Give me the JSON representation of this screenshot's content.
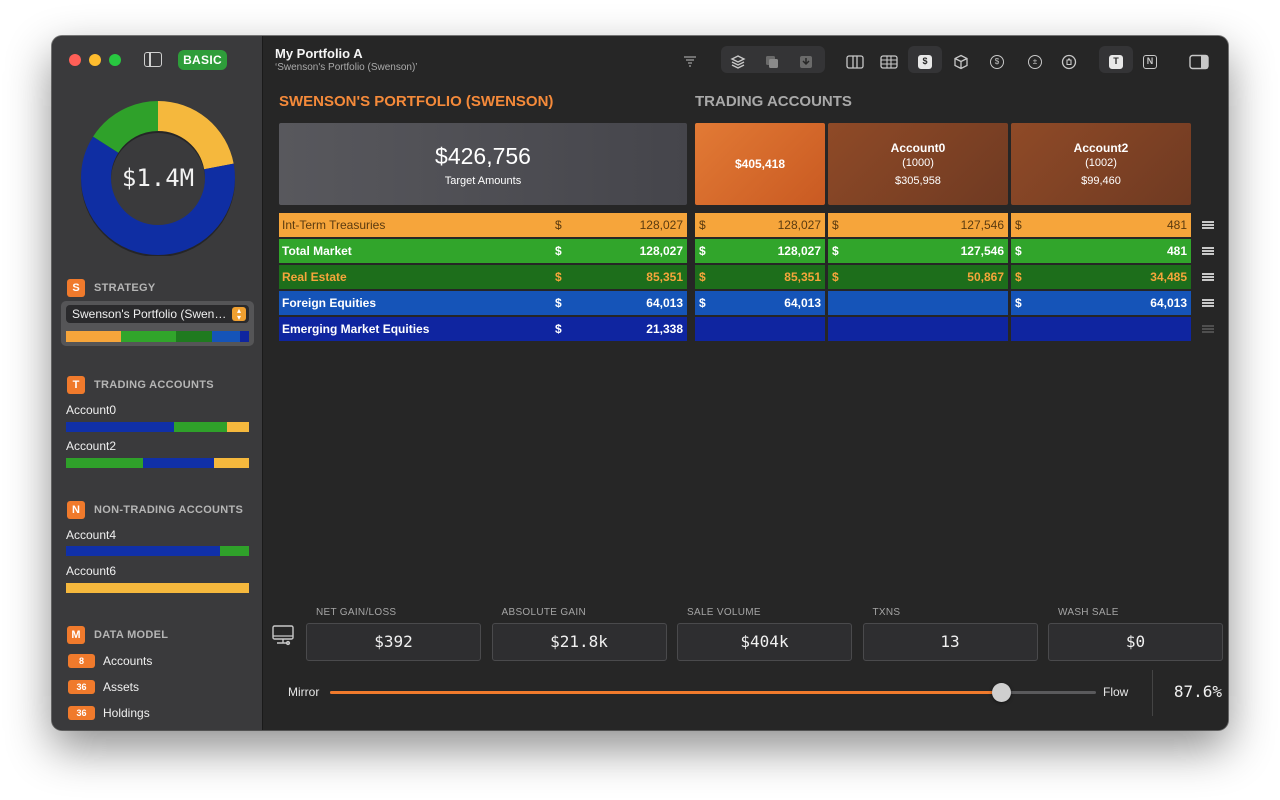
{
  "window": {
    "title": "My Portfolio A",
    "subtitle": "‘Swenson's Portfolio (Swenson)’"
  },
  "sidebar": {
    "badge": "BASIC",
    "donut": {
      "total_label": "$1.4M",
      "segments": [
        {
          "name": "orange",
          "fraction": 0.22,
          "color": "#f5b83d"
        },
        {
          "name": "blue",
          "fraction": 0.62,
          "color": "#0f2ea3"
        },
        {
          "name": "green",
          "fraction": 0.16,
          "color": "#2fa12a"
        }
      ]
    },
    "strategy": {
      "badge": "S",
      "title": "STRATEGY",
      "selected": "Swenson's Portfolio (Swen…",
      "bar": [
        {
          "color": "#f6a53b",
          "fraction": 0.3
        },
        {
          "color": "#31a52b",
          "fraction": 0.3
        },
        {
          "color": "#1f7a1f",
          "fraction": 0.2
        },
        {
          "color": "#1554b8",
          "fraction": 0.15
        },
        {
          "color": "#0f25a0",
          "fraction": 0.05
        }
      ]
    },
    "trading": {
      "badge": "T",
      "title": "TRADING ACCOUNTS",
      "accounts": [
        {
          "name": "Account0",
          "bar": [
            {
              "color": "#1030a8",
              "fraction": 0.59
            },
            {
              "color": "#2fa12a",
              "fraction": 0.29
            },
            {
              "color": "#f5b83d",
              "fraction": 0.12
            }
          ]
        },
        {
          "name": "Account2",
          "bar": [
            {
              "color": "#2fa12a",
              "fraction": 0.42
            },
            {
              "color": "#1030a8",
              "fraction": 0.39
            },
            {
              "color": "#f5b83d",
              "fraction": 0.19
            }
          ]
        }
      ]
    },
    "nontrading": {
      "badge": "N",
      "title": "NON-TRADING ACCOUNTS",
      "accounts": [
        {
          "name": "Account4",
          "bar": [
            {
              "color": "#1030a8",
              "fraction": 0.84
            },
            {
              "color": "#2fa12a",
              "fraction": 0.16
            }
          ]
        },
        {
          "name": "Account6",
          "bar": [
            {
              "color": "#f5b83d",
              "fraction": 1.0
            }
          ]
        }
      ]
    },
    "datamodel": {
      "badge": "M",
      "title": "DATA MODEL",
      "items": [
        {
          "count": "8",
          "label": "Accounts"
        },
        {
          "count": "36",
          "label": "Assets"
        },
        {
          "count": "36",
          "label": "Holdings"
        }
      ]
    }
  },
  "toolbar": {
    "icons": [
      "funnel-icon",
      "layers-icon",
      "copy-icon",
      "download-icon",
      "columns-icon",
      "table-icon",
      "dollar-square-icon",
      "cube-icon",
      "dollar-circle-icon",
      "plus-minus-icon",
      "trash-icon",
      "t-square-icon",
      "n-square-icon",
      "inspector-icon"
    ],
    "t_label": "T",
    "n_label": "N",
    "dollar_label": "$",
    "coin_label": "$",
    "plusminus_label": "±"
  },
  "main": {
    "portfolio_heading": "SWENSON'S PORTFOLIO (SWENSON)",
    "trading_heading": "TRADING ACCOUNTS",
    "target": {
      "amount": "$426,756",
      "label": "Target Amounts"
    },
    "accounts": [
      {
        "name": "",
        "id": "",
        "value": "$405,418"
      },
      {
        "name": "Account0",
        "id": "(1000)",
        "value": "$305,958"
      },
      {
        "name": "Account2",
        "id": "(1002)",
        "value": "$99,460"
      }
    ],
    "rows": [
      {
        "name": "Int-Term Treasuries",
        "target": "128,027",
        "cells": [
          "128,027",
          "127,546",
          "481"
        ],
        "bg": "#f6a53b",
        "fg": "#5a3a10",
        "bold": false
      },
      {
        "name": "Total Market",
        "target": "128,027",
        "cells": [
          "128,027",
          "127,546",
          "481"
        ],
        "bg": "#31a52b",
        "fg": "#ffffff",
        "bold": true
      },
      {
        "name": "Real Estate",
        "target": "85,351",
        "cells": [
          "85,351",
          "50,867",
          "34,485"
        ],
        "bg": "#1d6e1b",
        "fg": "#f6a53b",
        "bold": true
      },
      {
        "name": "Foreign Equities",
        "target": "64,013",
        "cells": [
          "64,013",
          "",
          "64,013"
        ],
        "bg": "#1554b8",
        "fg": "#ffffff",
        "bold": true
      },
      {
        "name": "Emerging Market Equities",
        "target": "21,338",
        "cells": [
          "",
          "",
          ""
        ],
        "bg": "#0f25a0",
        "fg": "#ffffff",
        "bold": true
      }
    ],
    "currency": "$"
  },
  "stats": [
    {
      "label": "NET GAIN/LOSS",
      "value": "$392"
    },
    {
      "label": "ABSOLUTE GAIN",
      "value": "$21.8k"
    },
    {
      "label": "SALE VOLUME",
      "value": "$404k"
    },
    {
      "label": "TXNS",
      "value": "13"
    },
    {
      "label": "WASH SALE",
      "value": "$0"
    }
  ],
  "slider": {
    "left_label": "Mirror",
    "right_label": "Flow",
    "value": 0.876,
    "value_label": "87.6%"
  }
}
